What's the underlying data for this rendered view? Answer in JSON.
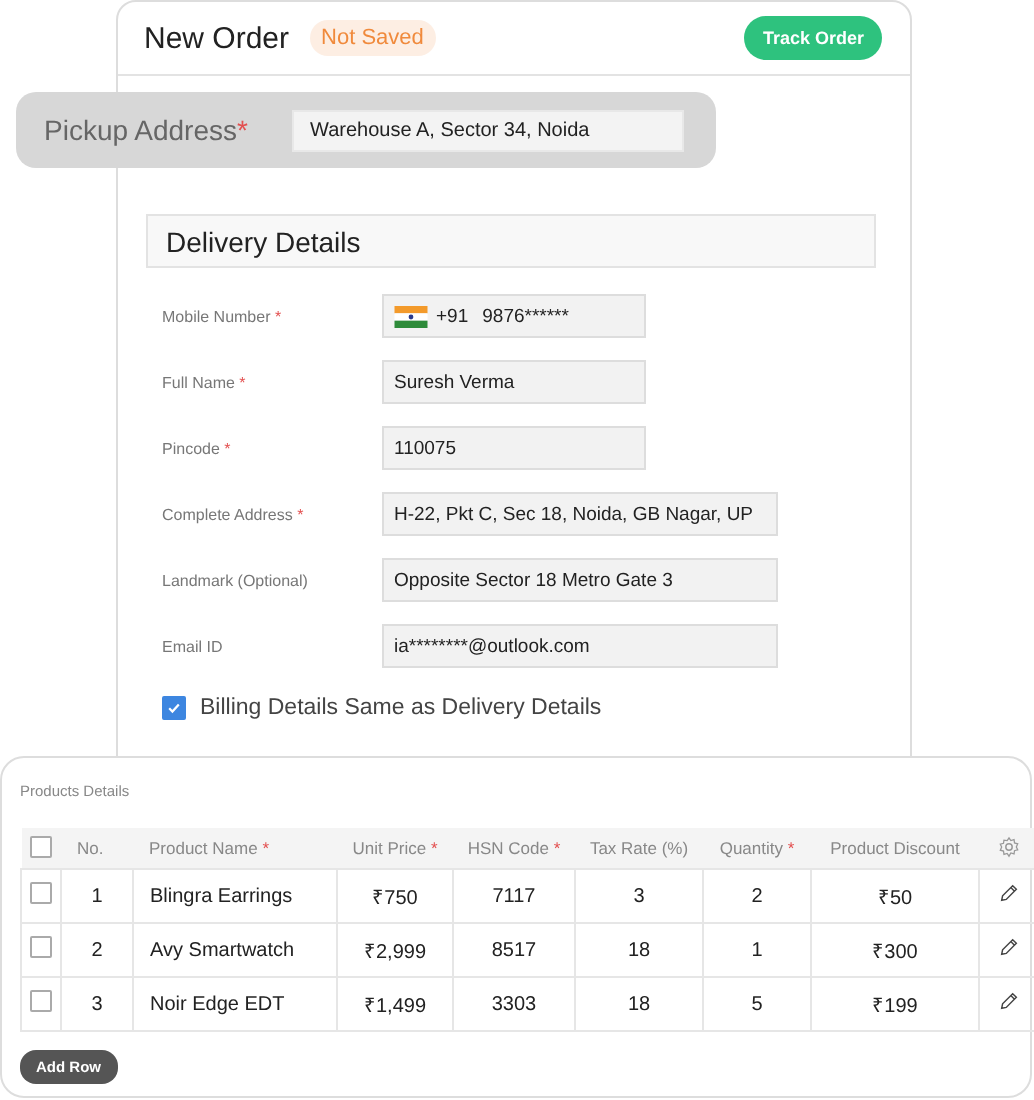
{
  "header": {
    "title": "New Order",
    "status": "Not Saved",
    "action": "Track Order"
  },
  "pickup": {
    "label": "Pickup Address",
    "mark": "*",
    "value": "Warehouse A, Sector 34, Noida"
  },
  "delivery": {
    "title": "Delivery Details",
    "fields": [
      {
        "label": "Mobile Number",
        "mark": "*",
        "kind": "phone",
        "code": "+91",
        "value": "9876******",
        "wide": false
      },
      {
        "label": "Full Name",
        "mark": "*",
        "kind": "text",
        "value": "Suresh Verma",
        "wide": false
      },
      {
        "label": "Pincode",
        "mark": "*",
        "kind": "text",
        "value": "110075",
        "wide": false
      },
      {
        "label": "Complete Address",
        "mark": "*",
        "kind": "text",
        "value": "H-22, Pkt C, Sec 18, Noida, GB Nagar, UP",
        "wide": true
      },
      {
        "label": "Landmark (Optional)",
        "kind": "text",
        "value": "Opposite Sector 18 Metro Gate 3",
        "wide": true
      },
      {
        "label": "Email ID",
        "kind": "text",
        "value": "ia********@outlook.com",
        "wide": true
      }
    ],
    "billing_same": {
      "label": "Billing Details Same as Delivery Details",
      "checked": true
    }
  },
  "products": {
    "title": "Products Details",
    "all_selected": false,
    "columns": [
      {
        "label": "No."
      },
      {
        "label": "Product Name",
        "mark": "*"
      },
      {
        "label": "Unit Price",
        "mark": "*"
      },
      {
        "label": "HSN Code",
        "mark": "*"
      },
      {
        "label": "Tax Rate (%)"
      },
      {
        "label": "Quantity",
        "mark": "*"
      },
      {
        "label": "Product Discount"
      }
    ],
    "rows": [
      {
        "selected": false,
        "cells": [
          "1",
          "Blingra Earrings",
          "₹750",
          "7117",
          "3",
          "2",
          "₹50"
        ]
      },
      {
        "selected": false,
        "cells": [
          "2",
          "Avy Smartwatch",
          "₹2,999",
          "8517",
          "18",
          "1",
          "₹300"
        ]
      },
      {
        "selected": false,
        "cells": [
          "3",
          "Noir Edge EDT",
          "₹1,499",
          "3303",
          "18",
          "5",
          "₹199"
        ]
      }
    ],
    "add_button": "Add Row"
  }
}
